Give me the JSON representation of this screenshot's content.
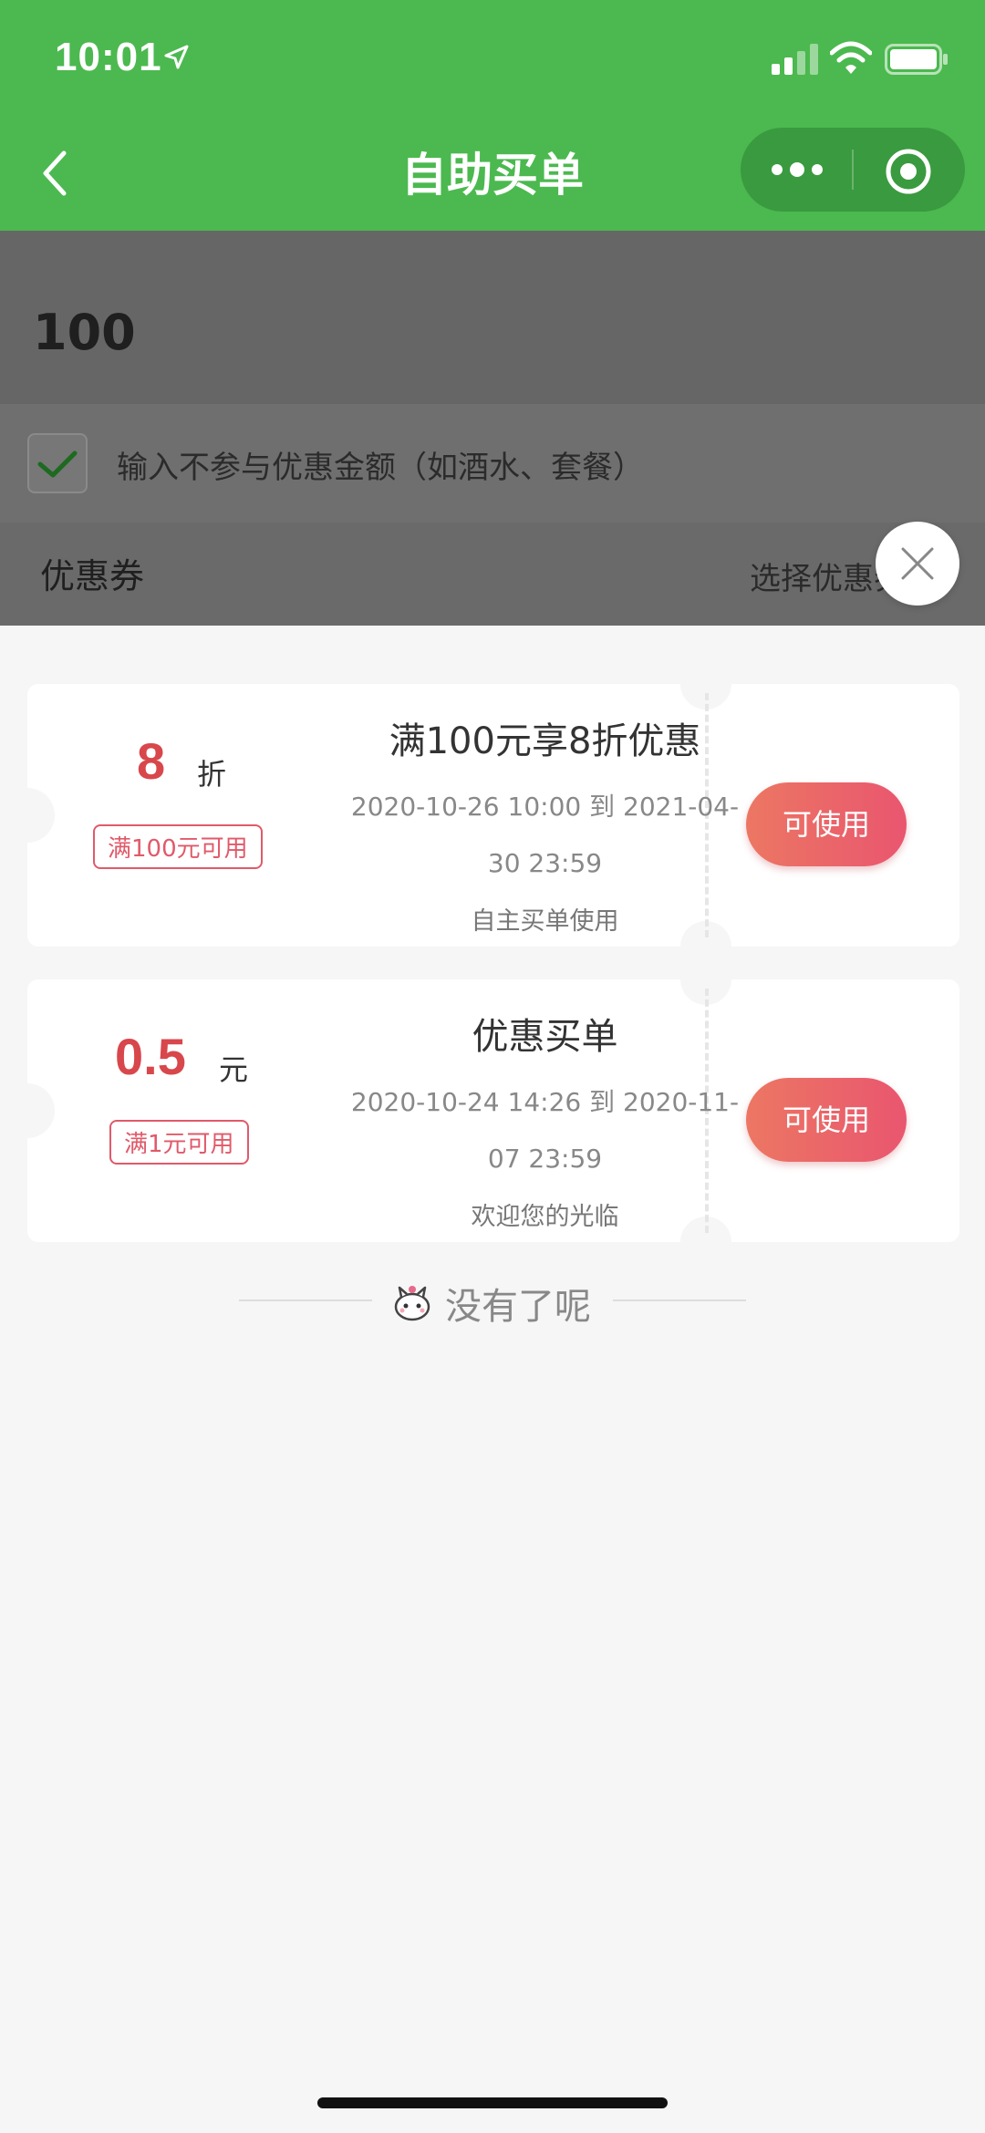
{
  "status_bar": {
    "time": "10:01"
  },
  "navbar": {
    "title": "自助买单"
  },
  "form": {
    "amount": "100",
    "exclude_label": "输入不参与优惠金额（如酒水、套餐）",
    "coupon_label": "优惠券",
    "coupon_select": "选择优惠券"
  },
  "coupons": [
    {
      "value": "8",
      "unit": "折",
      "condition": "满100元可用",
      "name": "满100元享8折优惠",
      "period_line1": "2020-10-26 10:00 到 2021-04-",
      "period_line2": "30 23:59",
      "desc": "自主买单使用",
      "button": "可使用"
    },
    {
      "value": "0.5",
      "unit": "元",
      "condition": "满1元可用",
      "name": "优惠买单",
      "period_line1": "2020-10-24 14:26 到 2020-11-",
      "period_line2": "07 23:59",
      "desc": "欢迎您的光临",
      "button": "可使用"
    }
  ],
  "end_text": "没有了呢",
  "colors": {
    "green": "#4bb94f",
    "red": "#d8474b",
    "button_gradient_start": "#ec7763",
    "button_gradient_end": "#e9566f"
  }
}
